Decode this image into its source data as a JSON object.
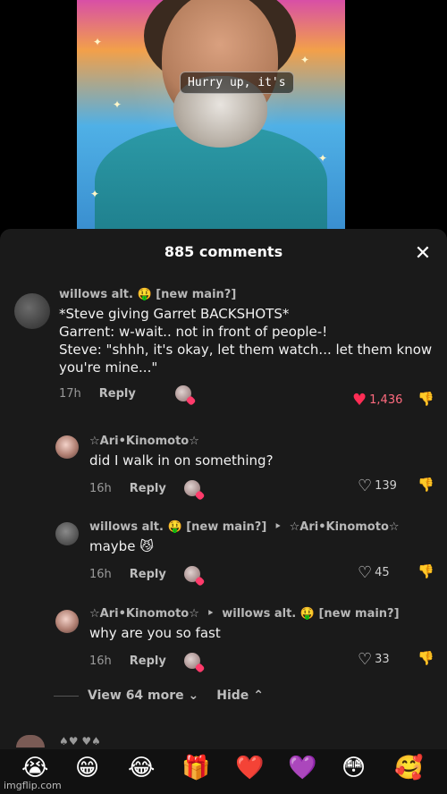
{
  "video": {
    "caption": "Hurry up, it's"
  },
  "sheet": {
    "title": "885 comments"
  },
  "comments": [
    {
      "username": "willows alt. 🤑 [new main?]",
      "lines": [
        "*Steve giving Garret BACKSHOTS*",
        "Garrent: w-wait.. not in front of people-!",
        "Steve: \"shhh, it's okay, let them watch... let them know",
        "you're mine...\""
      ],
      "time": "17h",
      "reply": "Reply",
      "likes": "1,436",
      "liked": true
    },
    {
      "username": "☆Ari•Kinomoto☆",
      "text": "did I walk in on something?",
      "time": "16h",
      "reply": "Reply",
      "likes": "139"
    },
    {
      "username": "willows alt. 🤑 [new main?]",
      "reply_to": "☆Ari•Kinomoto☆",
      "text": "maybe",
      "emoji": "😼",
      "time": "16h",
      "reply": "Reply",
      "likes": "45"
    },
    {
      "username": "☆Ari•Kinomoto☆",
      "reply_to": "willows alt. 🤑 [new main?]",
      "text": "why are you so fast",
      "time": "16h",
      "reply": "Reply",
      "likes": "33"
    }
  ],
  "thread": {
    "view_more": "View 64 more",
    "hide": "Hide"
  },
  "peek": {
    "username_fragment": "♠♥ ♥♠"
  },
  "emoji_bar": [
    "😭",
    "😁",
    "😂",
    "🎁",
    "❤️",
    "💜",
    "😳",
    "🥰"
  ],
  "watermark": "imgflip.com"
}
